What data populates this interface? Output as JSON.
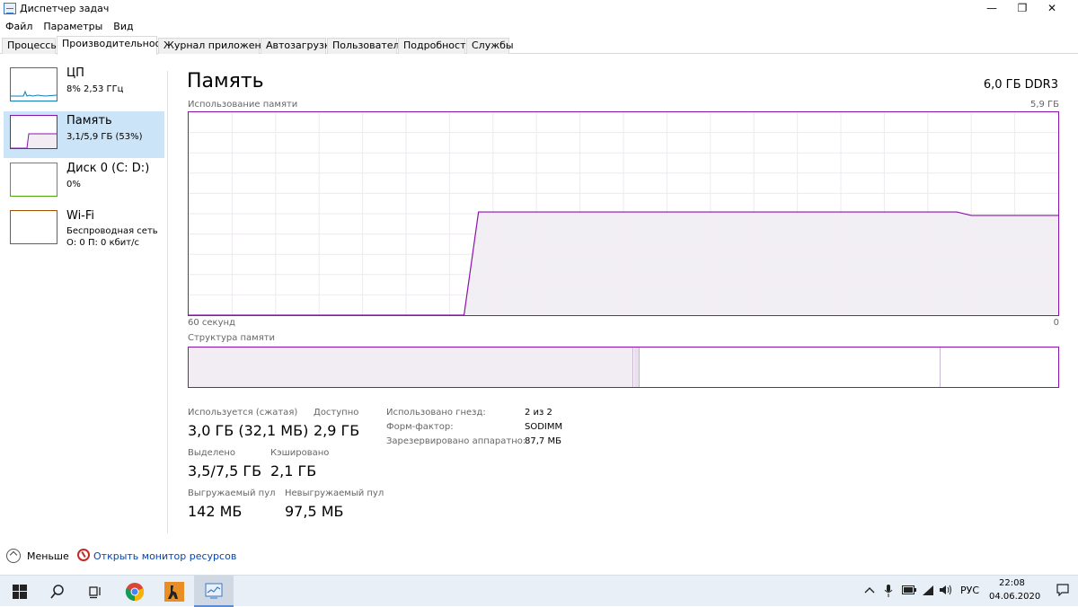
{
  "window": {
    "title": "Диспетчер задач",
    "controls": {
      "minimize": "—",
      "maximize": "❐",
      "close": "✕"
    }
  },
  "menu": [
    "Файл",
    "Параметры",
    "Вид"
  ],
  "tabs": [
    "Процессы",
    "Производительность",
    "Журнал приложений",
    "Автозагрузка",
    "Пользователи",
    "Подробности",
    "Службы"
  ],
  "active_tab": "Производительность",
  "sidebar": {
    "items": [
      {
        "name": "ЦП",
        "sub1": "8% 2,53 ГГц",
        "sub2": "",
        "color": "#117dbb"
      },
      {
        "name": "Память",
        "sub1": "3,1/5,9 ГБ (53%)",
        "sub2": "",
        "color": "#8b12ae"
      },
      {
        "name": "Диск 0 (C: D:)",
        "sub1": "0%",
        "sub2": "",
        "color": "#4da60c"
      },
      {
        "name": "Wi-Fi",
        "sub1": "Беспроводная сеть",
        "sub2": "О: 0 П: 0 кбит/с",
        "color": "#a74f01"
      }
    ]
  },
  "main": {
    "title": "Память",
    "spec": "6,0 ГБ DDR3",
    "usage_label": "Использование памяти",
    "usage_max": "5,9 ГБ",
    "time_left": "60 секунд",
    "time_right": "0",
    "structure_label": "Структура памяти"
  },
  "chart_data": {
    "type": "line",
    "title": "Использование памяти",
    "xlabel": "",
    "ylabel": "",
    "x_range": [
      60,
      0
    ],
    "ylim": [
      0,
      5.9
    ],
    "series": [
      {
        "x": [
          60,
          41,
          40,
          32,
          27,
          7,
          6,
          0
        ],
        "values": [
          0,
          0,
          3.0,
          3.0,
          3.0,
          3.0,
          2.9,
          2.9
        ]
      }
    ],
    "grid": true,
    "color": "#8b12ae"
  },
  "stats": {
    "in_use_label": "Используется (сжатая)",
    "in_use_value": "3,0 ГБ (32,1 МБ)",
    "available_label": "Доступно",
    "available_value": "2,9 ГБ",
    "committed_label": "Выделено",
    "committed_value": "3,5/7,5 ГБ",
    "cached_label": "Кэшировано",
    "cached_value": "2,1 ГБ",
    "paged_label": "Выгружаемый пул",
    "paged_value": "142 МБ",
    "nonpaged_label": "Невыгружаемый пул",
    "nonpaged_value": "97,5 МБ"
  },
  "details": {
    "slots_label": "Использовано гнезд:",
    "slots_value": "2 из 2",
    "form_label": "Форм-фактор:",
    "form_value": "SODIMM",
    "reserved_label": "Зарезервировано аппаратно:",
    "reserved_value": "87,7 МБ"
  },
  "footer": {
    "fewer": "Меньше",
    "resource_monitor": "Открыть монитор ресурсов"
  },
  "taskbar": {
    "language": "РУС",
    "time": "22:08",
    "date": "04.06.2020"
  }
}
